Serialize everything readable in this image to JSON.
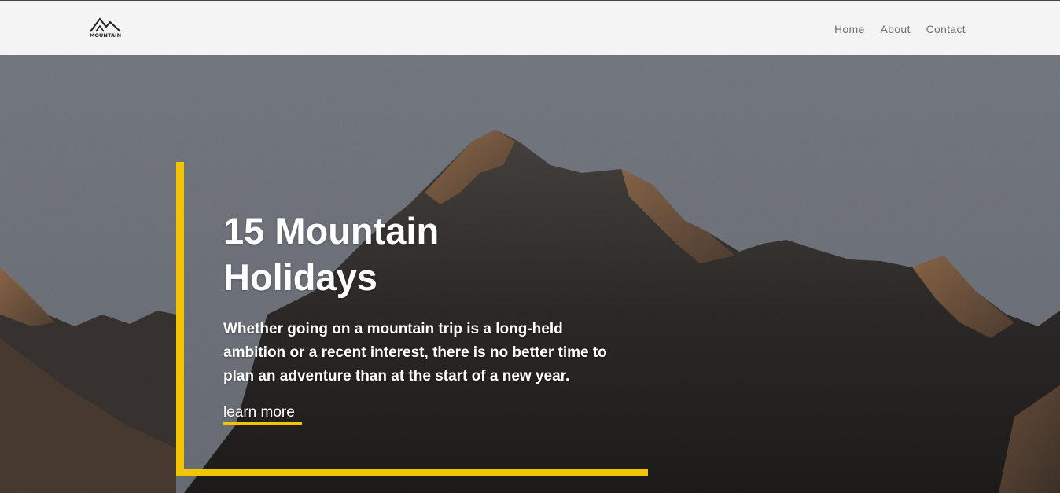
{
  "brand": {
    "logo_text": "MOUNTAIN",
    "icon": "mountain-logo-icon"
  },
  "nav": {
    "items": [
      {
        "label": "Home"
      },
      {
        "label": "About"
      },
      {
        "label": "Contact"
      }
    ]
  },
  "hero": {
    "title_line1": "15 Mountain",
    "title_line2": "Holidays",
    "description": "Whether going on a mountain trip is a long-held ambition or a recent interest, there is no better time to plan an adventure than at the start of a new year.",
    "cta_label": "learn more",
    "background": "mountain-peak-photo"
  },
  "colors": {
    "accent": "#f2c500",
    "header_bg": "#f4f4f4",
    "nav_text": "#707070",
    "sky": "#787c84",
    "text_on_hero": "#ffffff"
  }
}
